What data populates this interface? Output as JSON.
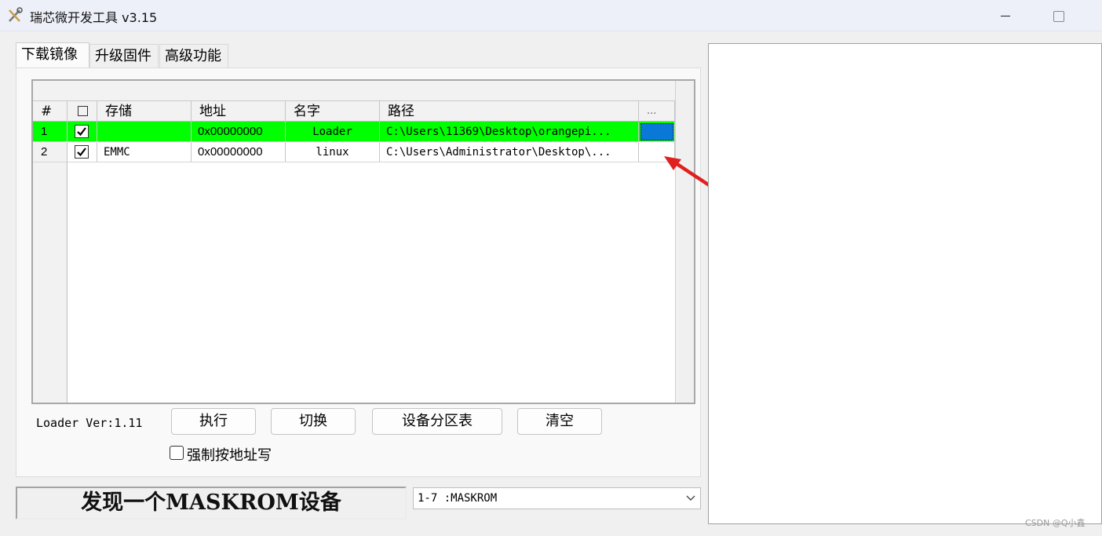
{
  "window": {
    "title": "瑞芯微开发工具 v3.15"
  },
  "tabs": [
    {
      "label": "下载镜像",
      "active": true
    },
    {
      "label": "升级固件",
      "active": false
    },
    {
      "label": "高级功能",
      "active": false
    }
  ],
  "table": {
    "headers": {
      "num": "#",
      "storage": "存储",
      "address": "地址",
      "name": "名字",
      "path": "路径",
      "more": "..."
    },
    "rows": [
      {
        "num": "1",
        "checked": true,
        "storage": "",
        "address": "0x00000000",
        "name": "Loader",
        "path": "C:\\Users\\11369\\Desktop\\orangepi...",
        "selected": true
      },
      {
        "num": "2",
        "checked": true,
        "storage": "EMMC",
        "address": "0x00000000",
        "name": "linux",
        "path": "C:\\Users\\Administrator\\Desktop\\...",
        "selected": false
      }
    ]
  },
  "loader_version": "Loader Ver:1.11",
  "buttons": {
    "execute": "执行",
    "switch": "切换",
    "partition_table": "设备分区表",
    "clear": "清空"
  },
  "force_address_write": {
    "label": "强制按地址写",
    "checked": false
  },
  "status": "发现一个MASKROM设备",
  "device_select": {
    "value": "1-7 :MASKROM"
  },
  "watermark": "CSDN @Q小鑫",
  "colors": {
    "selected_row": "#00ff00",
    "path_button": "#0a78d7",
    "annotation_arrow": "#e02020"
  }
}
